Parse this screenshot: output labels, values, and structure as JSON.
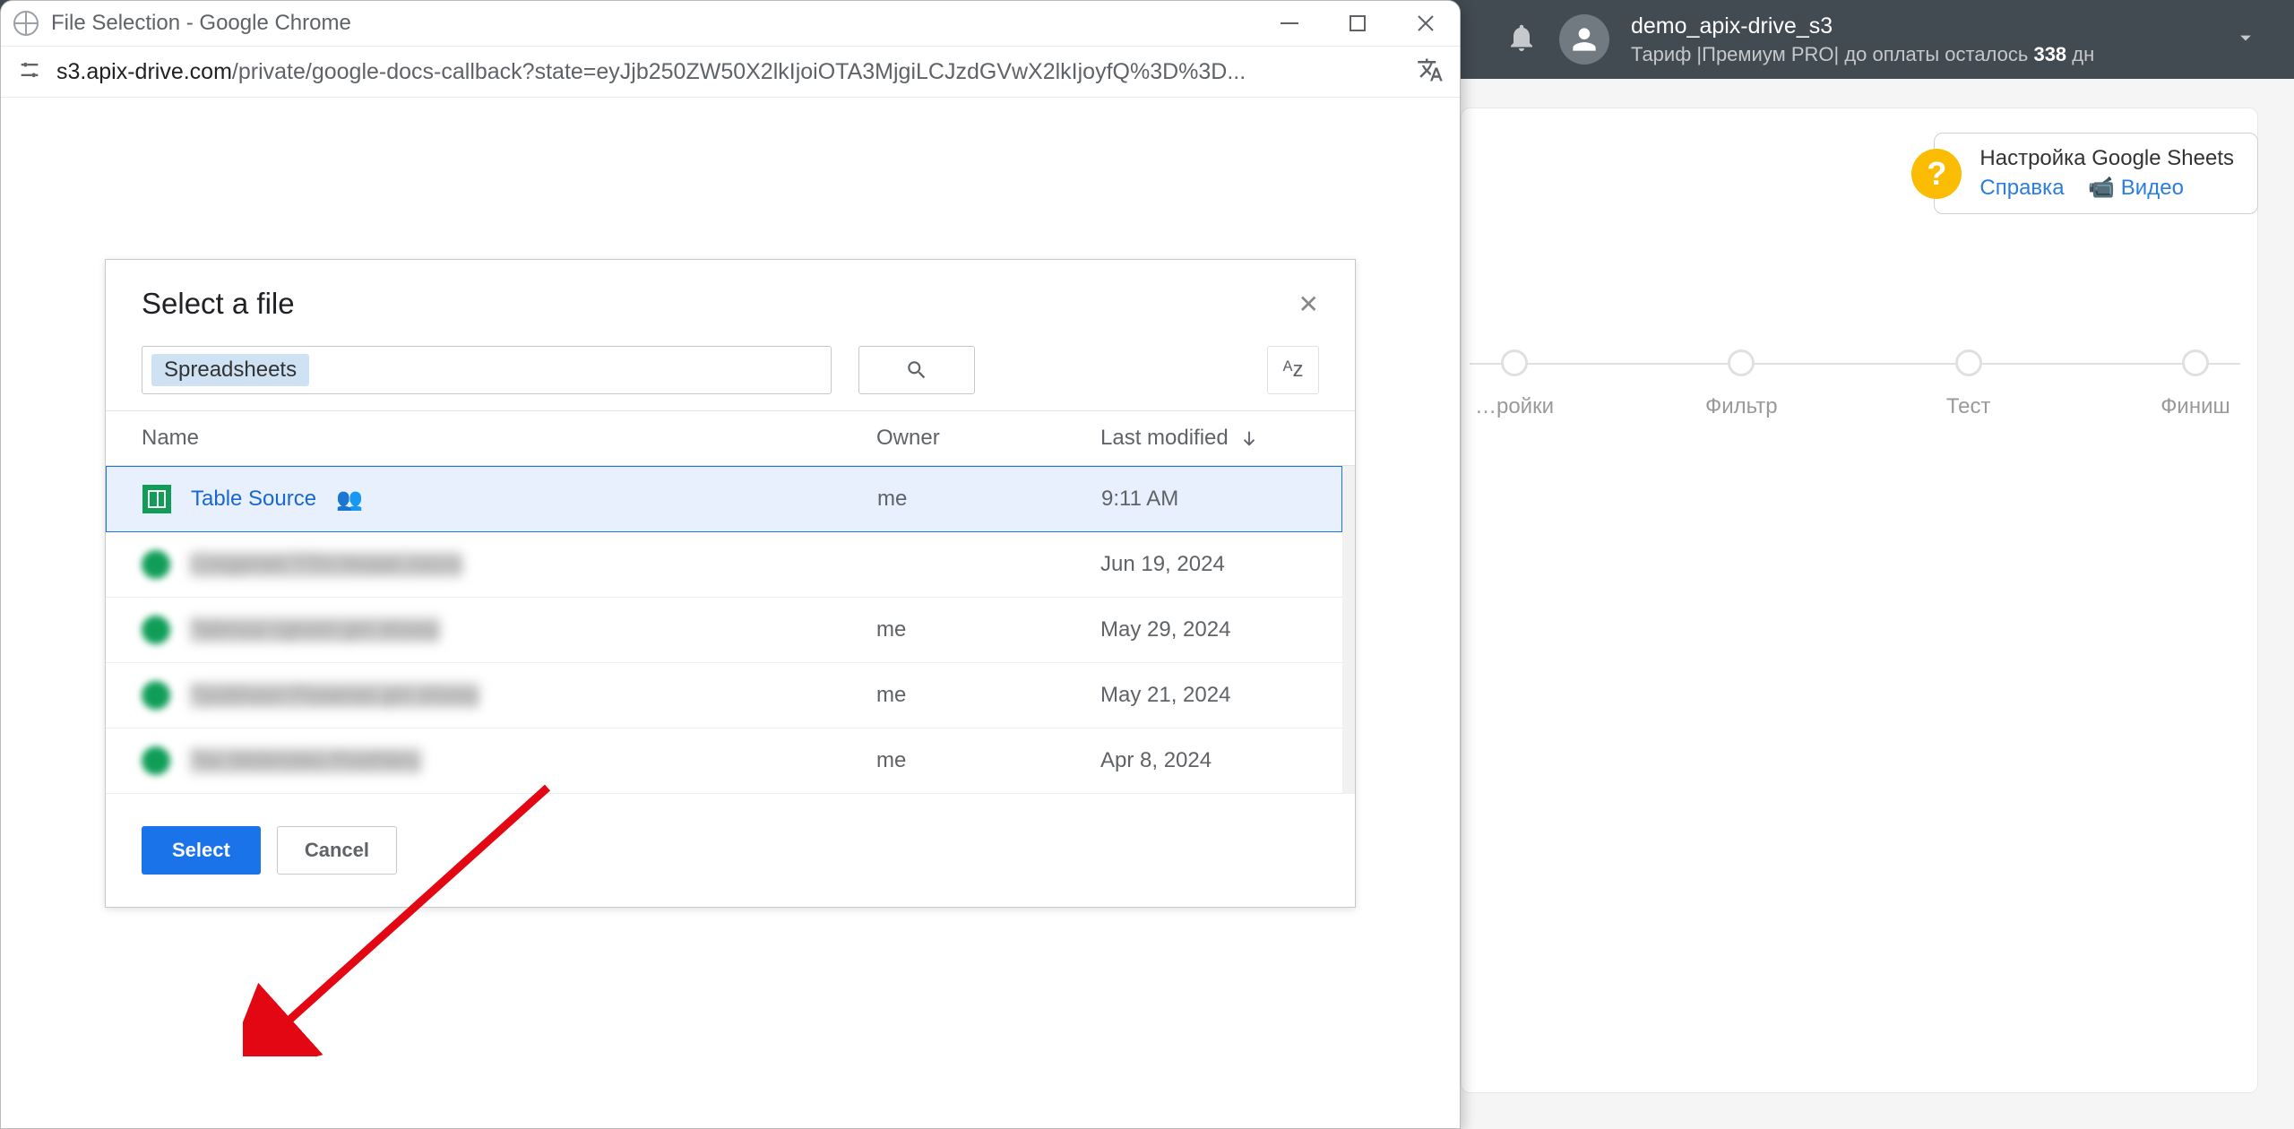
{
  "header": {
    "account_name": "demo_apix-drive_s3",
    "tariff_prefix": "Тариф |Премиум PRO| до оплаты осталось ",
    "tariff_days": "338",
    "tariff_suffix": " дн"
  },
  "help": {
    "title": "Настройка Google Sheets",
    "link_help": "Справка",
    "link_video": "Видео"
  },
  "progress": {
    "steps": [
      "…ройки",
      "Фильтр",
      "Тест",
      "Финиш"
    ]
  },
  "chrome": {
    "title": "File Selection - Google Chrome",
    "url_host": "s3.apix-drive.com",
    "url_path": "/private/google-docs-callback?state=eyJjb250ZW50X2lkIjoiOTA3MjgiLCJzdGVwX2lkIjoyfQ%3D%3D..."
  },
  "picker": {
    "title": "Select a file",
    "filter_chip": "Spreadsheets",
    "columns": {
      "name": "Name",
      "owner": "Owner",
      "modified": "Last modified"
    },
    "files": [
      {
        "name": "Table Source",
        "owner": "me",
        "modified": "9:11 AM",
        "selected": true,
        "shared": true,
        "blur": false
      },
      {
        "name": "Cosgeneii TTH Hoaan nocra",
        "owner": "",
        "modified": "Jun 19, 2024",
        "selected": false,
        "shared": false,
        "blur": true
      },
      {
        "name": "Tabmuo cgnom gm showy",
        "owner": "me",
        "modified": "May 29, 2024",
        "selected": false,
        "shared": false,
        "blur": true
      },
      {
        "name": "Tpobhasn Poaanas gm showy",
        "owner": "me",
        "modified": "May 21, 2024",
        "selected": false,
        "shared": false,
        "blur": true
      },
      {
        "name": "Tax Webnotes Posthlery",
        "owner": "me",
        "modified": "Apr 8, 2024",
        "selected": false,
        "shared": false,
        "blur": true
      }
    ],
    "select_btn": "Select",
    "cancel_btn": "Cancel"
  }
}
